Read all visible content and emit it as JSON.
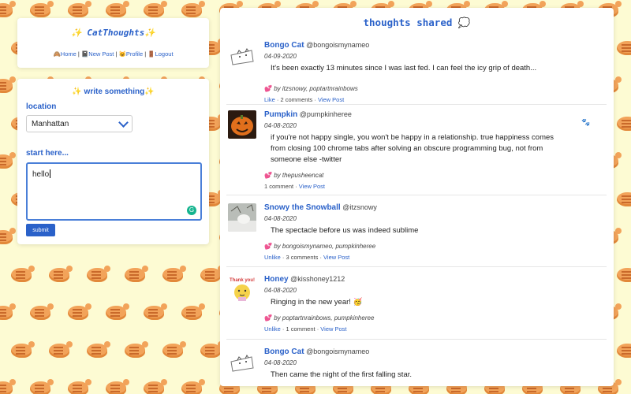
{
  "brand": {
    "title": "✨ CatThoughts✨",
    "nav": [
      {
        "icon": "🙈",
        "label": "Home"
      },
      {
        "icon": "📓",
        "label": "New Post"
      },
      {
        "icon": "😺",
        "label": "Profile"
      },
      {
        "icon": "🚪",
        "label": "Logout"
      }
    ]
  },
  "form": {
    "heading": "✨ write something✨",
    "location_label": "location",
    "location_value": "Manhattan",
    "text_label": "start here...",
    "text_value": "hello",
    "submit_label": "submit"
  },
  "feed": {
    "heading": "thoughts shared 💭",
    "posts": [
      {
        "name": "Bongo Cat",
        "handle": "@bongoismynameo",
        "date": "04-09-2020",
        "text": "It's been exactly 13 minutes since I was last fed. I can feel the icy grip of death...",
        "likes": "by itzsnowy, poptartnrainbows",
        "like_action": "Like",
        "comments": "2 comments",
        "view": "View Post"
      },
      {
        "name": "Pumpkin",
        "handle": "@pumpkinheree",
        "date": "04-08-2020",
        "text": "if you're not happy single, you won't be happy in a relationship. true happiness comes from closing 100 chrome tabs after solving an obscure programming bug, not from someone else -twitter",
        "likes": "by thepusheencat",
        "like_action": "",
        "comments": "1 comment",
        "view": "View Post",
        "badge": "🐾"
      },
      {
        "name": "Snowy the Snowball",
        "handle": "@itzsnowy",
        "date": "04-08-2020",
        "text": "The spectacle before us was indeed sublime",
        "likes": "by bongoismynameo, pumpkinheree",
        "like_action": "Unlike",
        "comments": "3 comments",
        "view": "View Post"
      },
      {
        "name": "Honey",
        "handle": "@kisshoney1212",
        "date": "04-08-2020",
        "text": "Ringing in the new year! 🥳",
        "likes": "by poptartnrainbows, pumpkinheree",
        "like_action": "Unlike",
        "comments": "1 comment",
        "view": "View Post"
      },
      {
        "name": "Bongo Cat",
        "handle": "@bongoismynameo",
        "date": "04-08-2020",
        "text": "Then came the night of the first falling star.",
        "likes": "",
        "like_action": "",
        "comments": "",
        "view": ""
      }
    ],
    "like_heart": "💕"
  },
  "colors": {
    "accent": "#2a61c9",
    "background": "#fdfbd3",
    "cat": "#f2a35a"
  }
}
